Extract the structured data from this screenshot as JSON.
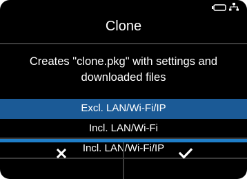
{
  "header": {
    "title": "Clone",
    "status_icons": [
      "keyboard-icon",
      "network-icon"
    ]
  },
  "description": "Creates \"clone.pkg\" with settings and downloaded files",
  "options": [
    {
      "label": "Excl. LAN/Wi-Fi/IP",
      "selected": true
    },
    {
      "label": "Incl. LAN/Wi-Fi",
      "selected": false
    },
    {
      "label": "Incl. LAN/Wi-Fi/IP",
      "selected": false
    }
  ],
  "softkeys": {
    "left_icon": "cancel-icon",
    "right_icon": "confirm-icon"
  },
  "colors": {
    "selected_row": "#1b5a96",
    "softkey_bar": "#1f7ec8",
    "background": "#000000"
  }
}
